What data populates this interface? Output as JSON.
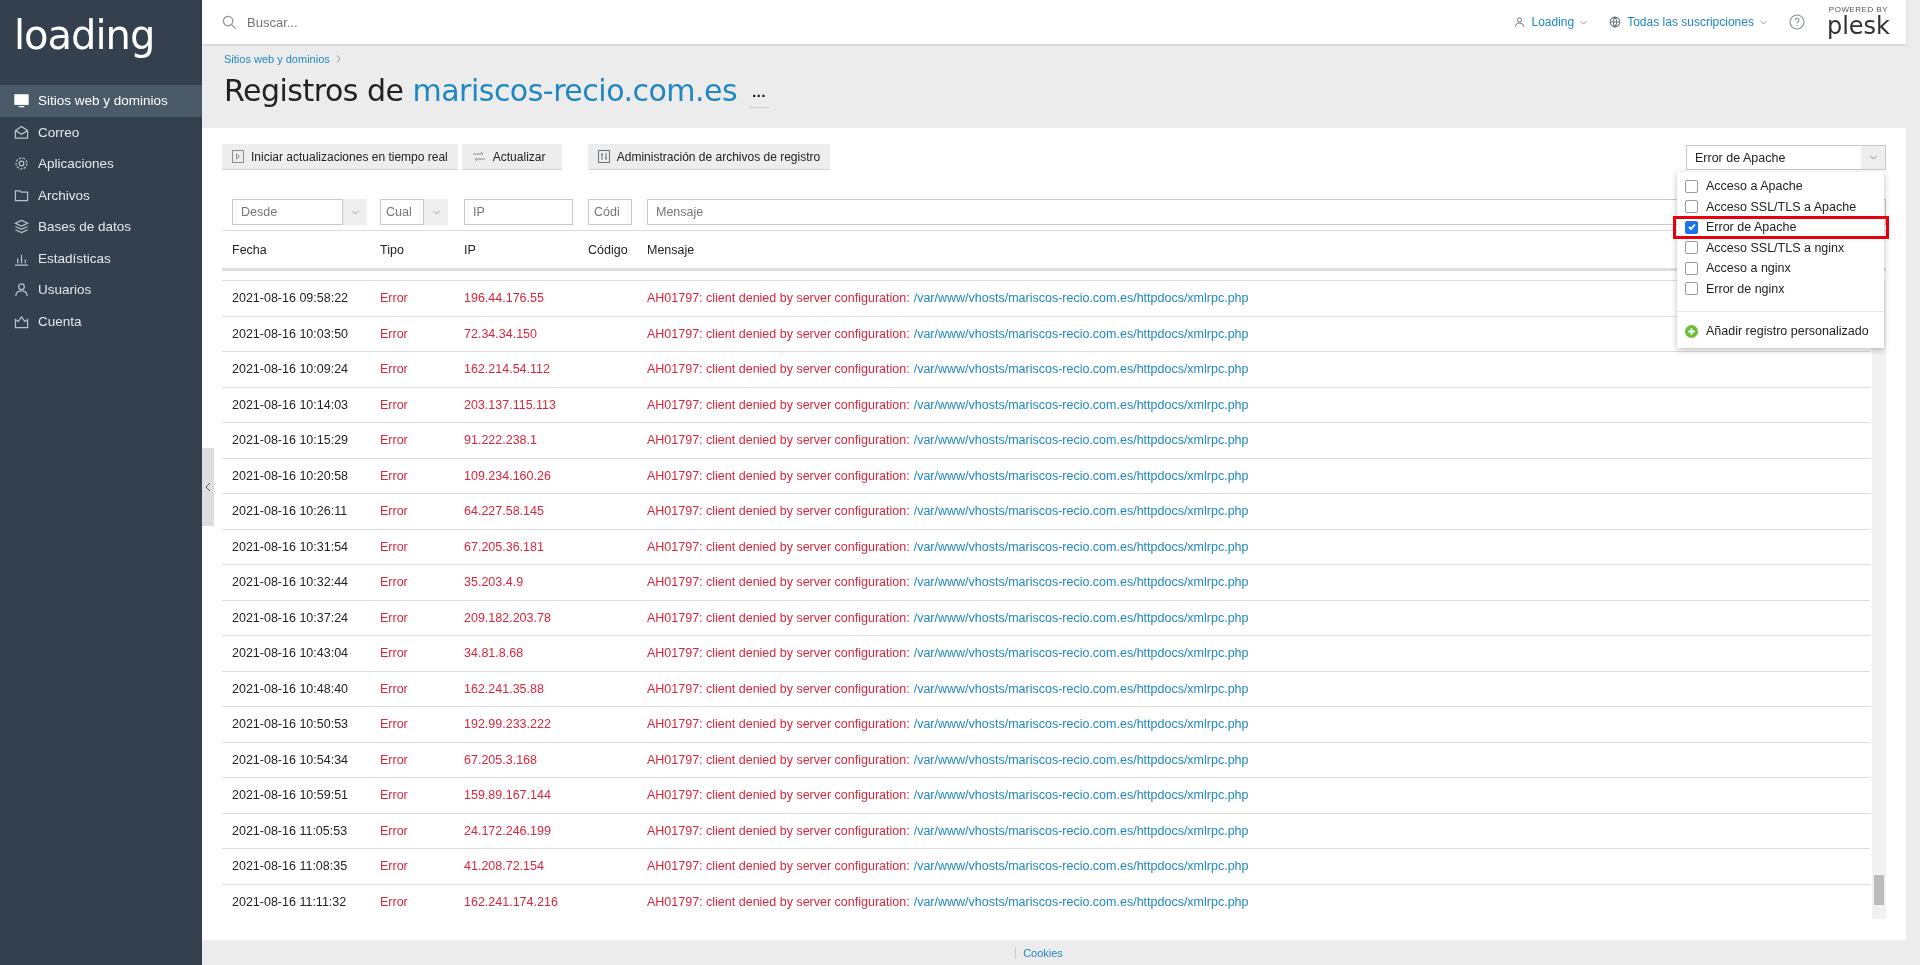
{
  "sidebar": {
    "logo": "loading",
    "items": [
      {
        "label": "Sitios web y dominios",
        "selected": true
      },
      {
        "label": "Correo",
        "selected": false
      },
      {
        "label": "Aplicaciones",
        "selected": false
      },
      {
        "label": "Archivos",
        "selected": false
      },
      {
        "label": "Bases de datos",
        "selected": false
      },
      {
        "label": "Estadísticas",
        "selected": false
      },
      {
        "label": "Usuarios",
        "selected": false
      },
      {
        "label": "Cuenta",
        "selected": false
      }
    ]
  },
  "topbar": {
    "search_placeholder": "Buscar...",
    "user": "Loading",
    "subscriptions": "Todas las suscripciones",
    "brand_tag": "POWERED BY",
    "brand": "plesk"
  },
  "breadcrumb": "Sitios web y dominios",
  "title": {
    "prefix": "Registros de",
    "domain": "mariscos-recio.com.es",
    "more": "···"
  },
  "toolbar": [
    "Iniciar actualizaciones en tiempo real",
    "Actualizar",
    "Administración de archivos de registro"
  ],
  "log_select": {
    "value": "Error de Apache",
    "options": [
      {
        "label": "Acceso a Apache",
        "checked": false,
        "highlighted": false
      },
      {
        "label": "Acceso SSL/TLS a Apache",
        "checked": false,
        "highlighted": false
      },
      {
        "label": "Error de Apache",
        "checked": true,
        "highlighted": true
      },
      {
        "label": "Acceso SSL/TLS a nginx",
        "checked": false,
        "highlighted": false
      },
      {
        "label": "Acceso a nginx",
        "checked": false,
        "highlighted": false
      },
      {
        "label": "Error de nginx",
        "checked": false,
        "highlighted": false
      }
    ],
    "add": "Añadir registro personalizado"
  },
  "filters": {
    "from": {
      "placeholder": "Desde"
    },
    "type": {
      "placeholder": "Cual"
    },
    "ip": {
      "placeholder": "IP"
    },
    "code": {
      "placeholder": "Códi"
    },
    "message": {
      "placeholder": "Mensaje"
    }
  },
  "table": {
    "columns": [
      "Fecha",
      "Tipo",
      "IP",
      "Código",
      "Mensaje"
    ],
    "rows": [
      {
        "date": "2021-08-16 09:58:22",
        "type": "Error",
        "ip": "196.44.176.55",
        "message": "AH01797: client denied by server configuration:",
        "path": "/var/www/vhosts/mariscos-recio.com.es/httpdocs/xmlrpc.php"
      },
      {
        "date": "2021-08-16 10:03:50",
        "type": "Error",
        "ip": "72.34.34.150",
        "message": "AH01797: client denied by server configuration:",
        "path": "/var/www/vhosts/mariscos-recio.com.es/httpdocs/xmlrpc.php"
      },
      {
        "date": "2021-08-16 10:09:24",
        "type": "Error",
        "ip": "162.214.54.112",
        "message": "AH01797: client denied by server configuration:",
        "path": "/var/www/vhosts/mariscos-recio.com.es/httpdocs/xmlrpc.php"
      },
      {
        "date": "2021-08-16 10:14:03",
        "type": "Error",
        "ip": "203.137.115.113",
        "message": "AH01797: client denied by server configuration:",
        "path": "/var/www/vhosts/mariscos-recio.com.es/httpdocs/xmlrpc.php"
      },
      {
        "date": "2021-08-16 10:15:29",
        "type": "Error",
        "ip": "91.222.238.1",
        "message": "AH01797: client denied by server configuration:",
        "path": "/var/www/vhosts/mariscos-recio.com.es/httpdocs/xmlrpc.php"
      },
      {
        "date": "2021-08-16 10:20:58",
        "type": "Error",
        "ip": "109.234.160.26",
        "message": "AH01797: client denied by server configuration:",
        "path": "/var/www/vhosts/mariscos-recio.com.es/httpdocs/xmlrpc.php"
      },
      {
        "date": "2021-08-16 10:26:11",
        "type": "Error",
        "ip": "64.227.58.145",
        "message": "AH01797: client denied by server configuration:",
        "path": "/var/www/vhosts/mariscos-recio.com.es/httpdocs/xmlrpc.php"
      },
      {
        "date": "2021-08-16 10:31:54",
        "type": "Error",
        "ip": "67.205.36.181",
        "message": "AH01797: client denied by server configuration:",
        "path": "/var/www/vhosts/mariscos-recio.com.es/httpdocs/xmlrpc.php"
      },
      {
        "date": "2021-08-16 10:32:44",
        "type": "Error",
        "ip": "35.203.4.9",
        "message": "AH01797: client denied by server configuration:",
        "path": "/var/www/vhosts/mariscos-recio.com.es/httpdocs/xmlrpc.php"
      },
      {
        "date": "2021-08-16 10:37:24",
        "type": "Error",
        "ip": "209.182.203.78",
        "message": "AH01797: client denied by server configuration:",
        "path": "/var/www/vhosts/mariscos-recio.com.es/httpdocs/xmlrpc.php"
      },
      {
        "date": "2021-08-16 10:43:04",
        "type": "Error",
        "ip": "34.81.8.68",
        "message": "AH01797: client denied by server configuration:",
        "path": "/var/www/vhosts/mariscos-recio.com.es/httpdocs/xmlrpc.php"
      },
      {
        "date": "2021-08-16 10:48:40",
        "type": "Error",
        "ip": "162.241.35.88",
        "message": "AH01797: client denied by server configuration:",
        "path": "/var/www/vhosts/mariscos-recio.com.es/httpdocs/xmlrpc.php"
      },
      {
        "date": "2021-08-16 10:50:53",
        "type": "Error",
        "ip": "192.99.233.222",
        "message": "AH01797: client denied by server configuration:",
        "path": "/var/www/vhosts/mariscos-recio.com.es/httpdocs/xmlrpc.php"
      },
      {
        "date": "2021-08-16 10:54:34",
        "type": "Error",
        "ip": "67.205.3.168",
        "message": "AH01797: client denied by server configuration:",
        "path": "/var/www/vhosts/mariscos-recio.com.es/httpdocs/xmlrpc.php"
      },
      {
        "date": "2021-08-16 10:59:51",
        "type": "Error",
        "ip": "159.89.167.144",
        "message": "AH01797: client denied by server configuration:",
        "path": "/var/www/vhosts/mariscos-recio.com.es/httpdocs/xmlrpc.php"
      },
      {
        "date": "2021-08-16 11:05:53",
        "type": "Error",
        "ip": "24.172.246.199",
        "message": "AH01797: client denied by server configuration:",
        "path": "/var/www/vhosts/mariscos-recio.com.es/httpdocs/xmlrpc.php"
      },
      {
        "date": "2021-08-16 11:08:35",
        "type": "Error",
        "ip": "41.208.72.154",
        "message": "AH01797: client denied by server configuration:",
        "path": "/var/www/vhosts/mariscos-recio.com.es/httpdocs/xmlrpc.php"
      },
      {
        "date": "2021-08-16 11:11:32",
        "type": "Error",
        "ip": "162.241.174.216",
        "message": "AH01797: client denied by server configuration:",
        "path": "/var/www/vhosts/mariscos-recio.com.es/httpdocs/xmlrpc.php"
      }
    ]
  },
  "footer": "Cookies"
}
